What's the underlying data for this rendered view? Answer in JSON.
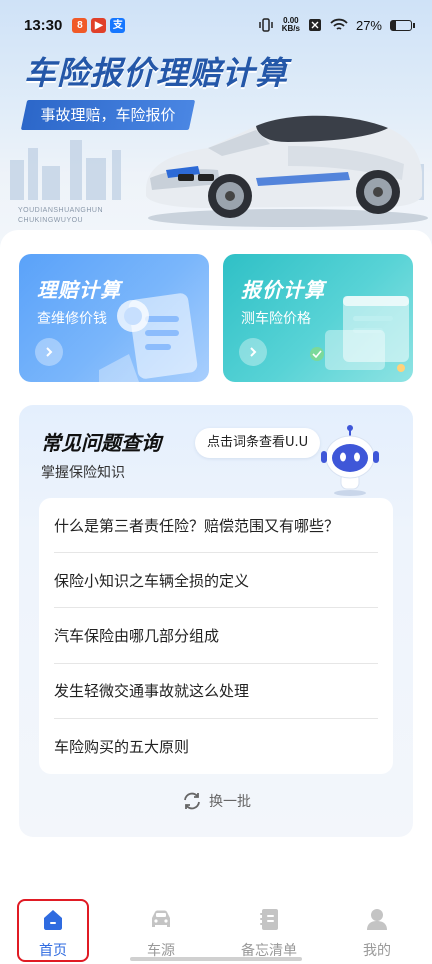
{
  "status_bar": {
    "time": "13:30",
    "net_speed_value": "0.00",
    "net_speed_unit": "KB/s",
    "battery": "27%",
    "battery_level": 0.27
  },
  "hero": {
    "title": "车险报价理赔计算",
    "subtitle": "事故理赔，车险报价",
    "pinyin_line1": "YOUDIANSHUANGHUN",
    "pinyin_line2": "CHUKINGWUYOU"
  },
  "cards": [
    {
      "title": "理赔计算",
      "desc": "查维修价钱"
    },
    {
      "title": "报价计算",
      "desc": "测车险价格"
    }
  ],
  "faq": {
    "title": "常见问题查询",
    "subtitle": "掌握保险知识",
    "bubble": "点击词条查看U.U",
    "items": [
      "什么是第三者责任险？赔偿范围又有哪些？",
      "保险小知识之车辆全损的定义",
      "汽车保险由哪几部分组成",
      "发生轻微交通事故就这么处理",
      "车险购买的五大原则"
    ],
    "refresh": "换一批"
  },
  "tabs": [
    {
      "label": "首页",
      "icon": "home-icon",
      "active": true
    },
    {
      "label": "车源",
      "icon": "car-icon",
      "active": false
    },
    {
      "label": "备忘清单",
      "icon": "notebook-icon",
      "active": false
    },
    {
      "label": "我的",
      "icon": "user-icon",
      "active": false
    }
  ],
  "colors": {
    "accent": "#2f6be0",
    "claim_card": "#5aa2f9",
    "quote_card": "#2fc0c6",
    "highlight": "#e01b24"
  }
}
